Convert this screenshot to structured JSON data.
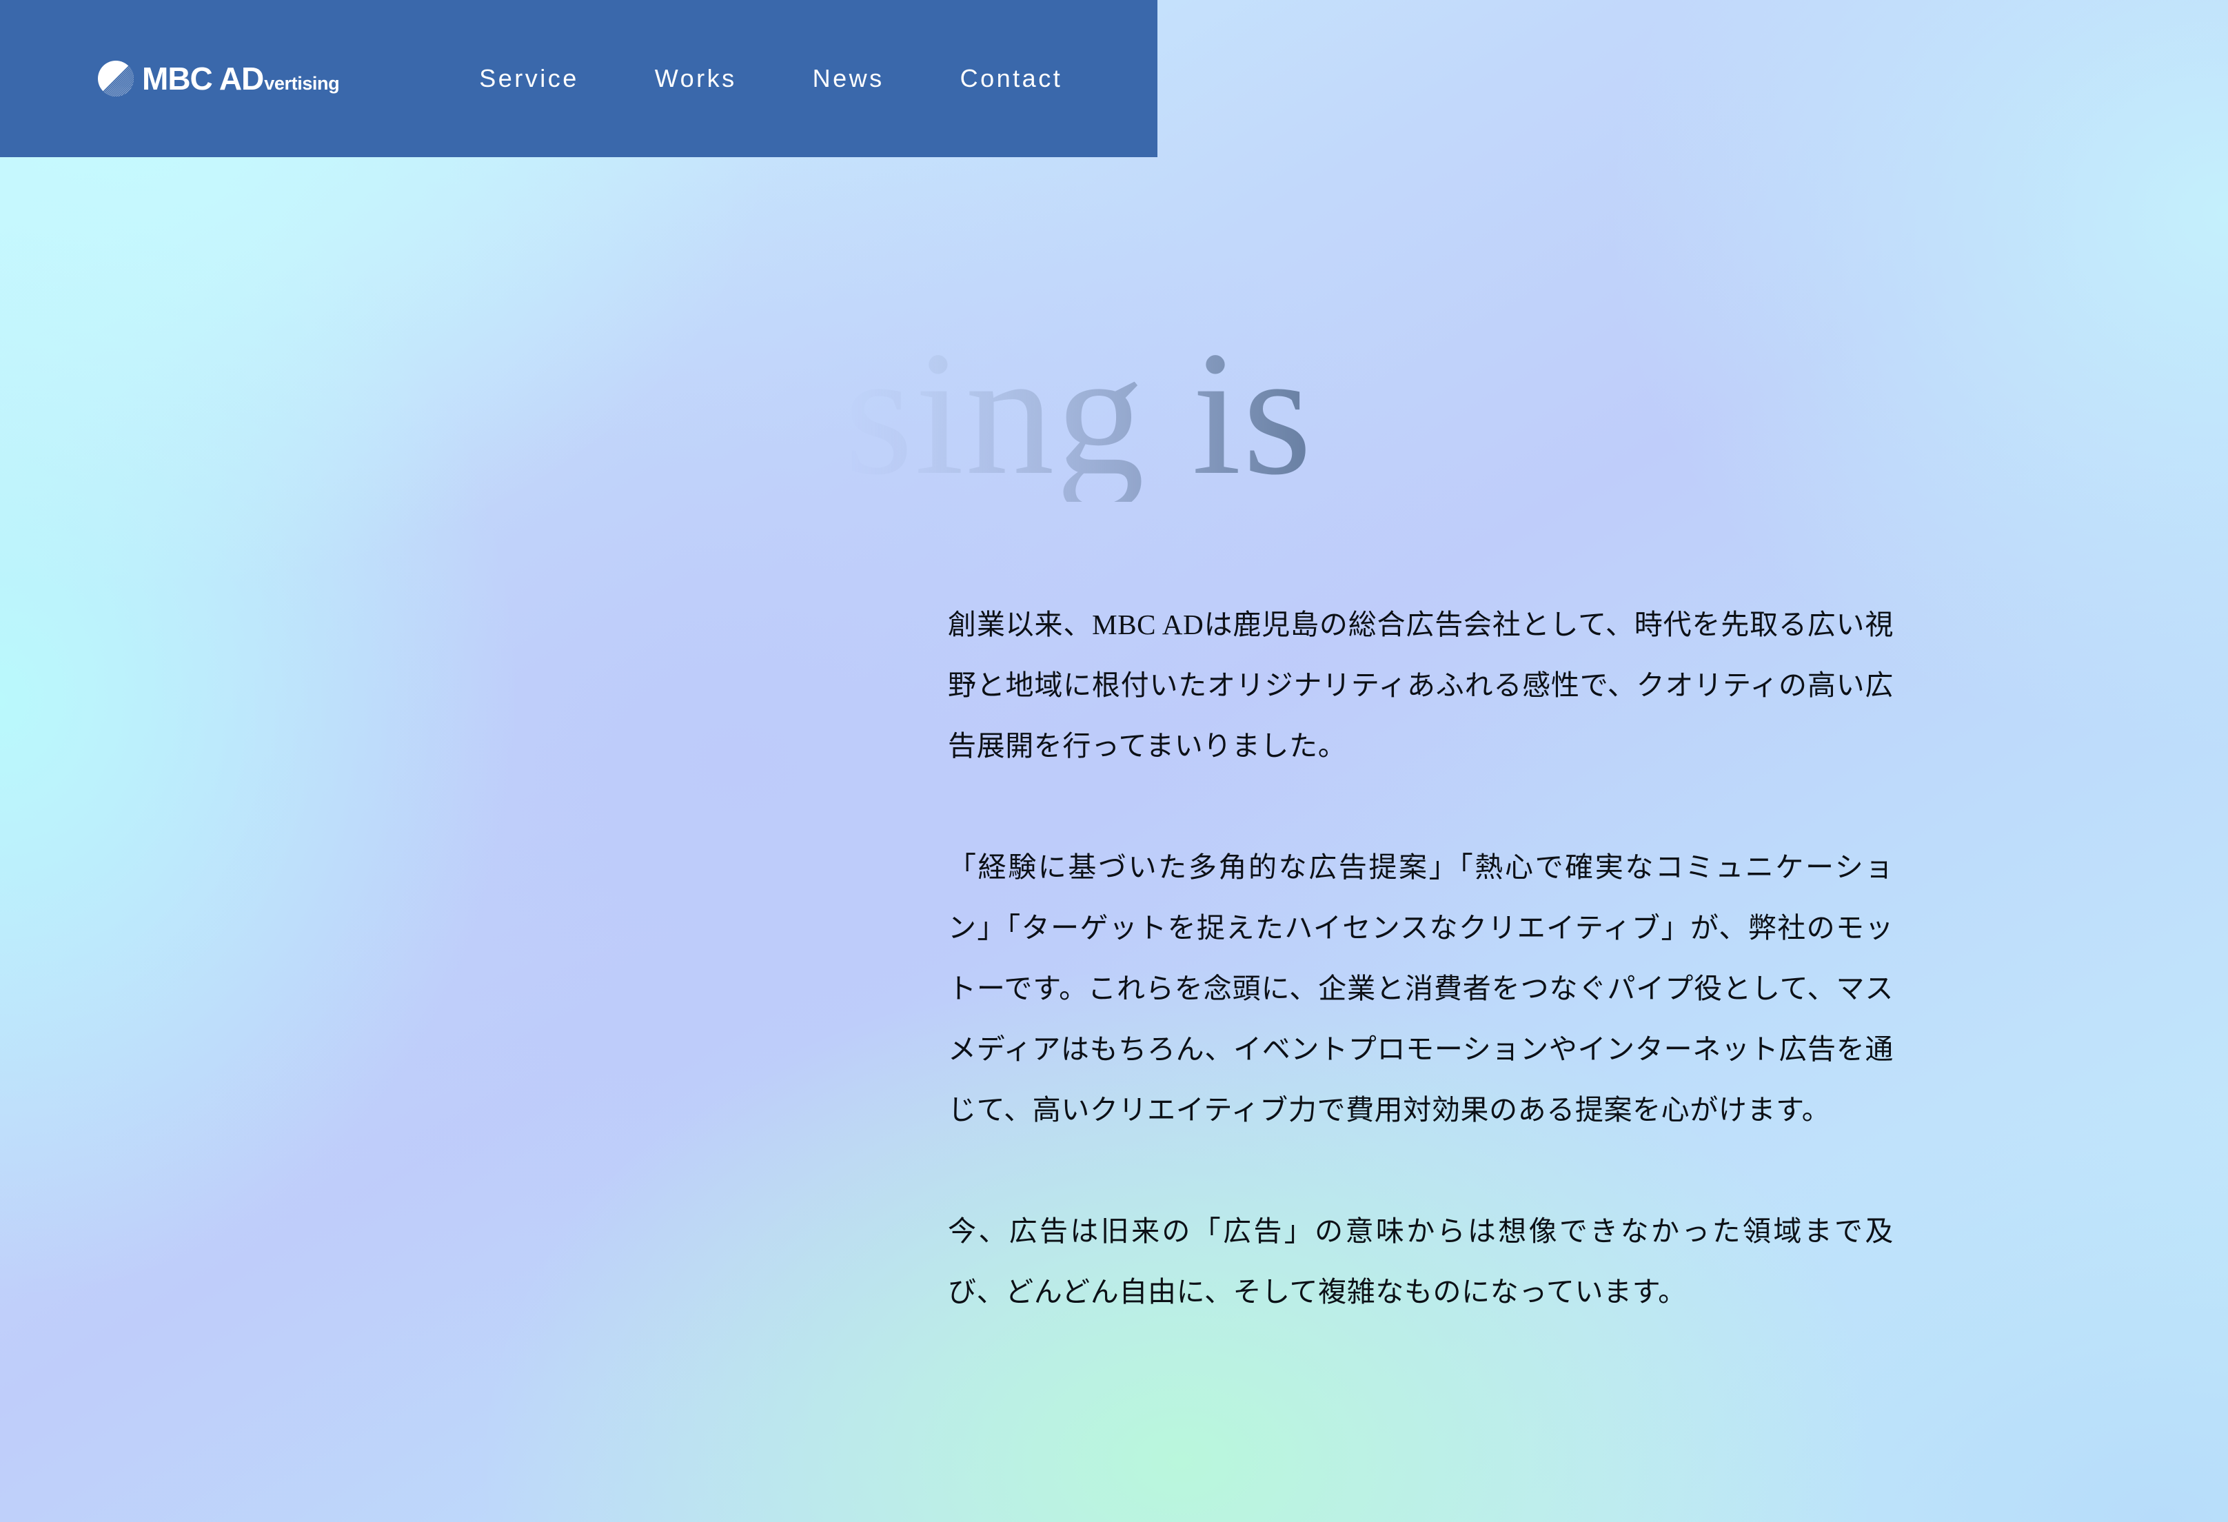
{
  "theme": {
    "nav_bg": "#3a68ab",
    "nav_text": "#ffffff",
    "body_text": "#0c1016",
    "bg_cyan": "#c5fafe",
    "bg_periwinkle": "#bfcdfa",
    "bg_mint": "#baf7dc",
    "hero_gradient_start": "rgba(120,140,170,0)",
    "hero_gradient_end": "rgba(88,112,146,0.85)"
  },
  "header": {
    "logo": {
      "mark_icon": "striped-circle-icon",
      "main_text": "MBC AD",
      "sub_text": "vertising",
      "full_name": "MBC ADvertising"
    },
    "nav_items": [
      {
        "label": "Service"
      },
      {
        "label": "Works"
      },
      {
        "label": "News"
      },
      {
        "label": "Contact"
      }
    ]
  },
  "hero": {
    "display_word": "sing is"
  },
  "main": {
    "paragraphs": [
      "創業以来、MBC ADは鹿児島の総合広告会社として、時代を先取る広い視野と地域に根付いたオリジナリティあふれる感性で、クオリティの高い広告展開を行ってまいりました。",
      "「経験に基づいた多角的な広告提案」「熱心で確実なコミュニケーション」「ターゲットを捉えたハイセンスなクリエイティブ」が、弊社のモットーです。これらを念頭に、企業と消費者をつなぐパイプ役として、マスメディアはもちろん、イベントプロモーションやインターネット広告を通じて、高いクリエイティブ力で費用対効果のある提案を心がけます。",
      "今、広告は旧来の「広告」の意味からは想像できなかった領域まで及び、どんどん自由に、そして複雑なものになっています。"
    ]
  }
}
